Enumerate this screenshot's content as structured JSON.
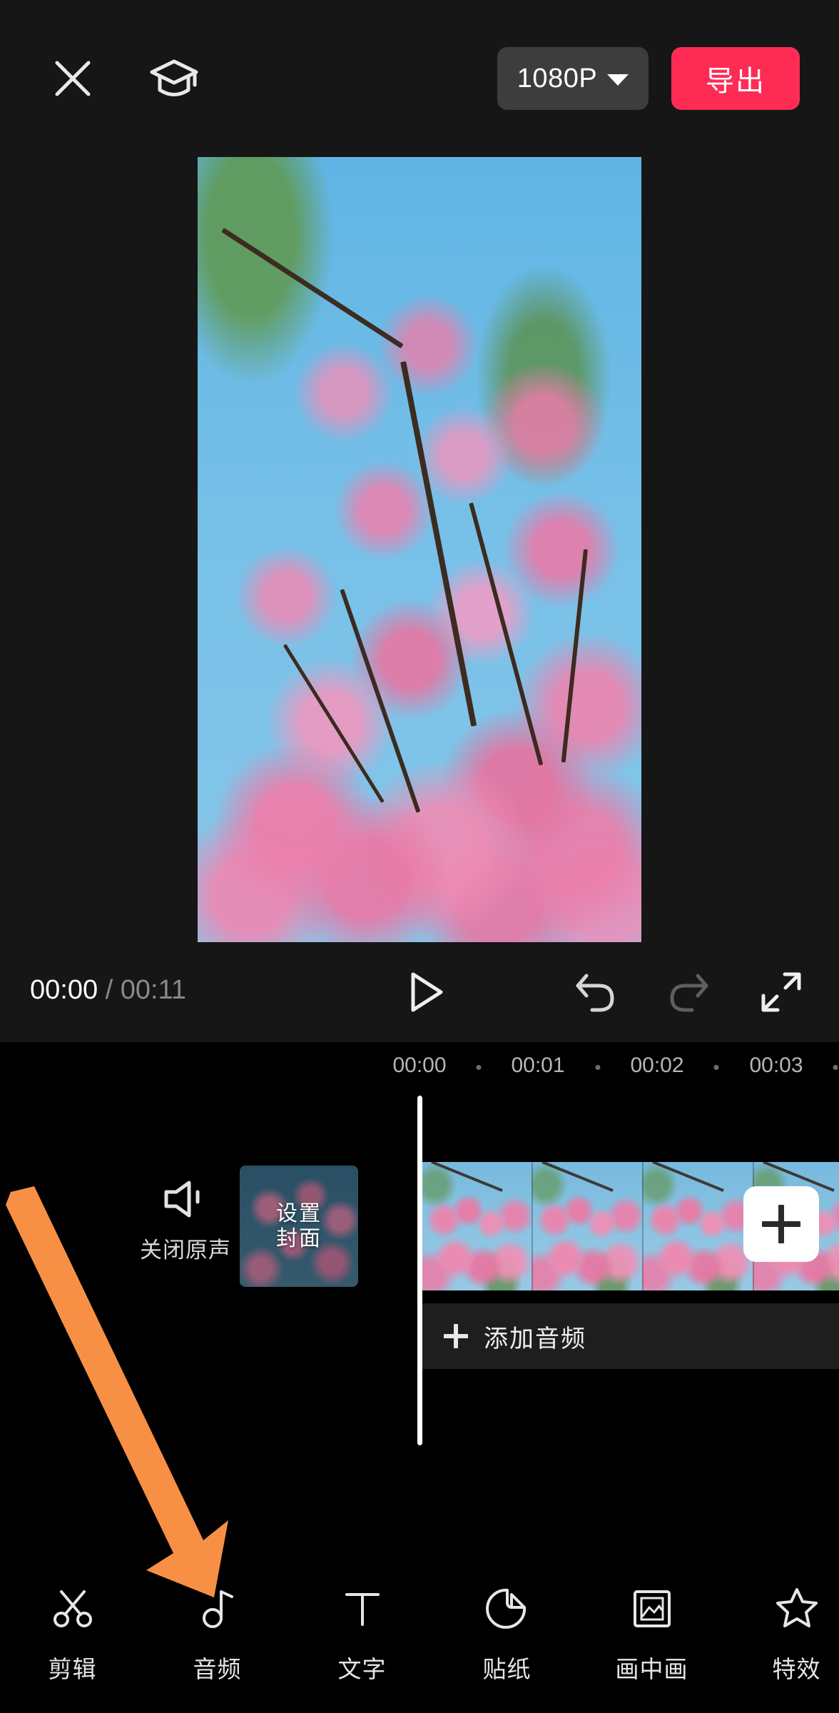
{
  "header": {
    "close_icon": "close-icon",
    "tutorial_icon": "graduation-cap-icon",
    "resolution_label": "1080P",
    "resolution_caret": "chevron-down-icon",
    "export_label": "导出"
  },
  "preview": {
    "description": "pink cherry blossom branches against blue sky"
  },
  "playback": {
    "current_time": "00:00",
    "separator": "/",
    "total_time": "00:11",
    "play_icon": "play-icon",
    "undo_icon": "undo-icon",
    "redo_icon": "redo-icon",
    "fullscreen_icon": "fullscreen-icon"
  },
  "timeline": {
    "ruler_labels": [
      "00:00",
      "00:01",
      "00:02",
      "00:03"
    ],
    "ruler_positions": [
      588,
      754,
      921,
      1088
    ],
    "dot_positions": [
      671,
      838,
      1004,
      1171
    ],
    "mute_label": "关闭原声",
    "mute_icon": "speaker-mute-icon",
    "cover_label": "设置\n封面",
    "cover_line1": "设置",
    "cover_line2": "封面",
    "add_clip_label": "+",
    "audio_track_label": "添加音频",
    "audio_track_plus": "plus-icon",
    "video_frames": 4
  },
  "annotation": {
    "arrow_color": "#F79044",
    "points_to": "音频"
  },
  "toolbar": {
    "items": [
      {
        "label": "剪辑",
        "icon": "scissors-icon"
      },
      {
        "label": "音频",
        "icon": "music-note-icon"
      },
      {
        "label": "文字",
        "icon": "text-t-icon"
      },
      {
        "label": "贴纸",
        "icon": "sticker-icon"
      },
      {
        "label": "画中画",
        "icon": "picture-in-picture-icon"
      },
      {
        "label": "特效",
        "icon": "star-effects-icon"
      }
    ]
  },
  "colors": {
    "accent_red": "#fe2c55",
    "annotation_orange": "#F79044",
    "panel_bg": "#161616",
    "timeline_bg": "#000000",
    "chip_bg": "#3d3d3d"
  }
}
